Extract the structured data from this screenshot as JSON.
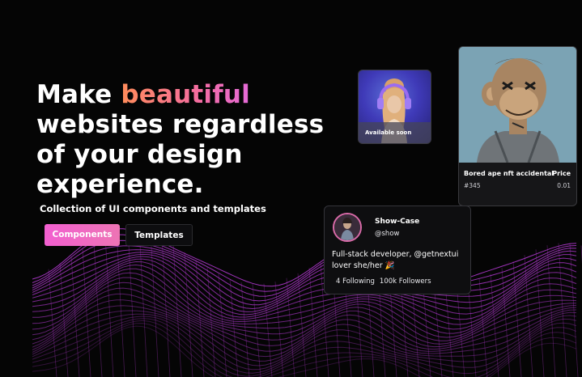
{
  "hero": {
    "headline_pre": "Make ",
    "headline_accent": "beautiful",
    "headline_line2": "websites regardless",
    "headline_line3": "of your design",
    "headline_line4": "experience.",
    "subtitle": "Collection of UI components and templates"
  },
  "buttons": {
    "primary": "Components",
    "secondary": "Templates"
  },
  "card_soon": {
    "badge": "Available soon"
  },
  "nft_card": {
    "title": "Bored ape nft accidental",
    "id": "#345",
    "price_label": "Price",
    "price": "0.01"
  },
  "profile_card": {
    "name": "Show-Case",
    "handle": "@show",
    "bio": "Full-stack developer, @getnextui lover she/her 🎉",
    "following": "4 Following",
    "followers": "100k Followers"
  },
  "colors": {
    "accent_start": "#ff8c5a",
    "accent_end": "#e56ad8",
    "primary_button": "#f25fd0",
    "wave": "#b83bd8",
    "background": "#050505"
  }
}
